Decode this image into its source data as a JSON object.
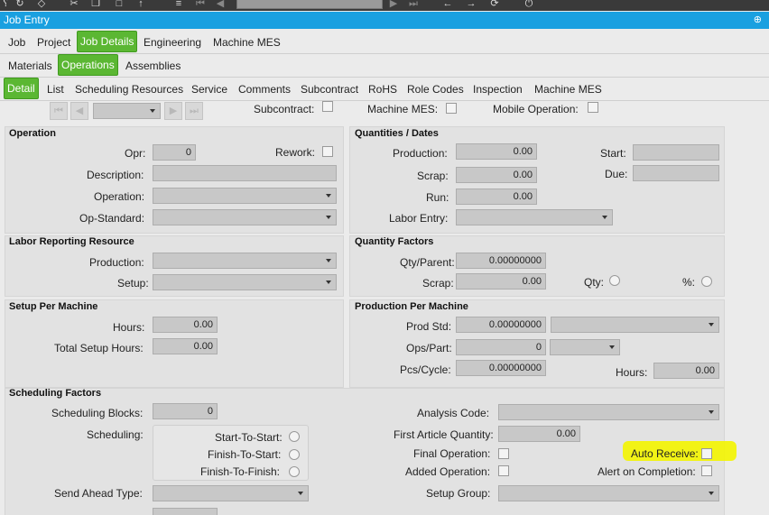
{
  "toolbar": {
    "icons": [
      "bracket-icon",
      "tag-icon",
      "scissors-icon",
      "copy-icon",
      "paste-icon",
      "hook-icon",
      "list-icon",
      "first-record-icon",
      "prev-record-icon",
      "next-record-icon",
      "last-record-icon",
      "back-icon",
      "forward-icon",
      "refresh-icon",
      "power-icon"
    ]
  },
  "window": {
    "title": "Job Entry",
    "pin": "⊕"
  },
  "tabs_row1": [
    "Job",
    "Project",
    "Job Details",
    "Engineering",
    "Machine MES"
  ],
  "tabs_row2": [
    "Materials",
    "Operations",
    "Assemblies"
  ],
  "tabs_row3": [
    "Detail",
    "List",
    "Scheduling Resources",
    "Service",
    "Comments",
    "Subcontract",
    "RoHS",
    "Role Codes",
    "Inspection",
    "Machine MES"
  ],
  "header": {
    "subcontract_label": "Subcontract:",
    "machine_mes_label": "Machine MES:",
    "mobile_operation_label": "Mobile Operation:"
  },
  "operation": {
    "title": "Operation",
    "opr_label": "Opr:",
    "opr_value": "0",
    "rework_label": "Rework:",
    "description_label": "Description:",
    "operation_label": "Operation:",
    "op_standard_label": "Op-Standard:"
  },
  "quantities": {
    "title": "Quantities / Dates",
    "production_label": "Production:",
    "production_value": "0.00",
    "scrap_label": "Scrap:",
    "scrap_value": "0.00",
    "run_label": "Run:",
    "run_value": "0.00",
    "labor_entry_label": "Labor Entry:",
    "start_label": "Start:",
    "due_label": "Due:"
  },
  "labor_resource": {
    "title": "Labor Reporting Resource",
    "production_label": "Production:",
    "setup_label": "Setup:"
  },
  "quantity_factors": {
    "title": "Quantity Factors",
    "qty_parent_label": "Qty/Parent:",
    "qty_parent_value": "0.00000000",
    "scrap_label": "Scrap:",
    "scrap_value": "0.00",
    "qty_label": "Qty:",
    "pct_label": "%:"
  },
  "setup_per_machine": {
    "title": "Setup Per Machine",
    "hours_label": "Hours:",
    "hours_value": "0.00",
    "total_label": "Total Setup Hours:",
    "total_value": "0.00"
  },
  "production_per_machine": {
    "title": "Production Per Machine",
    "prod_std_label": "Prod Std:",
    "prod_std_value": "0.00000000",
    "ops_part_label": "Ops/Part:",
    "ops_part_value": "0",
    "pcs_cycle_label": "Pcs/Cycle:",
    "pcs_cycle_value": "0.00000000",
    "hours_label": "Hours:",
    "hours_value": "0.00"
  },
  "scheduling": {
    "title": "Scheduling Factors",
    "blocks_label": "Scheduling Blocks:",
    "blocks_value": "0",
    "scheduling_label": "Scheduling:",
    "sts_label": "Start-To-Start:",
    "fts_label": "Finish-To-Start:",
    "ftf_label": "Finish-To-Finish:",
    "send_ahead_label": "Send Ahead Type:",
    "analysis_code_label": "Analysis Code:",
    "first_article_label": "First Article Quantity:",
    "first_article_value": "0.00",
    "final_operation_label": "Final Operation:",
    "auto_receive_label": "Auto Receive:",
    "added_operation_label": "Added Operation:",
    "alert_label": "Alert on Completion:",
    "setup_group_label": "Setup Group:"
  },
  "colors": {
    "titlebar": "#1aa0e0",
    "active_tab": "#5bb733",
    "highlight": "#f4f500"
  }
}
